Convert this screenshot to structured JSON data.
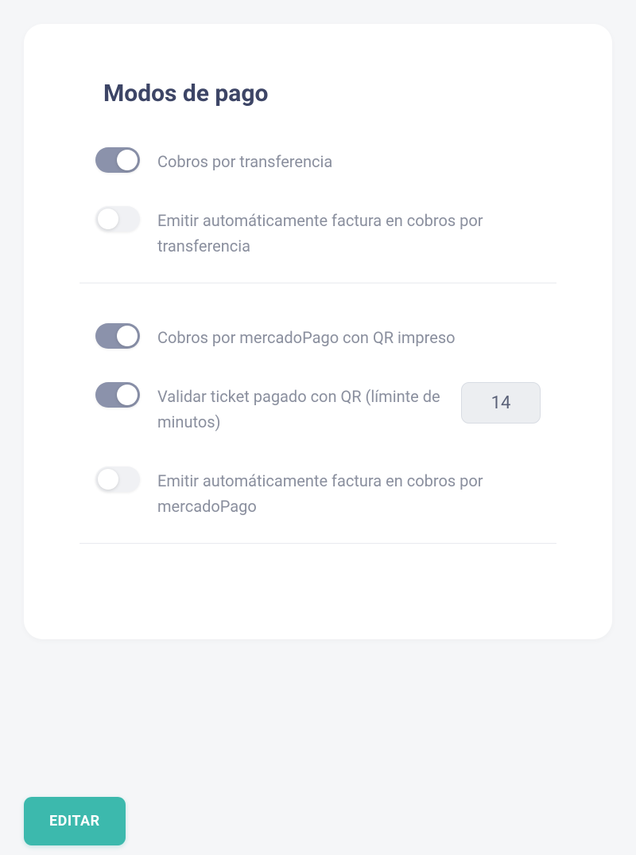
{
  "title": "Modos de pago",
  "groups": [
    {
      "items": [
        {
          "label": "Cobros por transferencia",
          "on": true
        },
        {
          "label": "Emitir automáticamente factura en cobros por transferencia",
          "on": false
        }
      ]
    },
    {
      "items": [
        {
          "label": "Cobros por mercadoPago con QR impreso",
          "on": true
        },
        {
          "label": "Validar ticket pagado con QR (líminte de minutos)",
          "on": true,
          "input_value": "14"
        },
        {
          "label": "Emitir automáticamente factura en cobros por mercadoPago",
          "on": false
        }
      ]
    }
  ],
  "edit_button_label": "EDITAR"
}
